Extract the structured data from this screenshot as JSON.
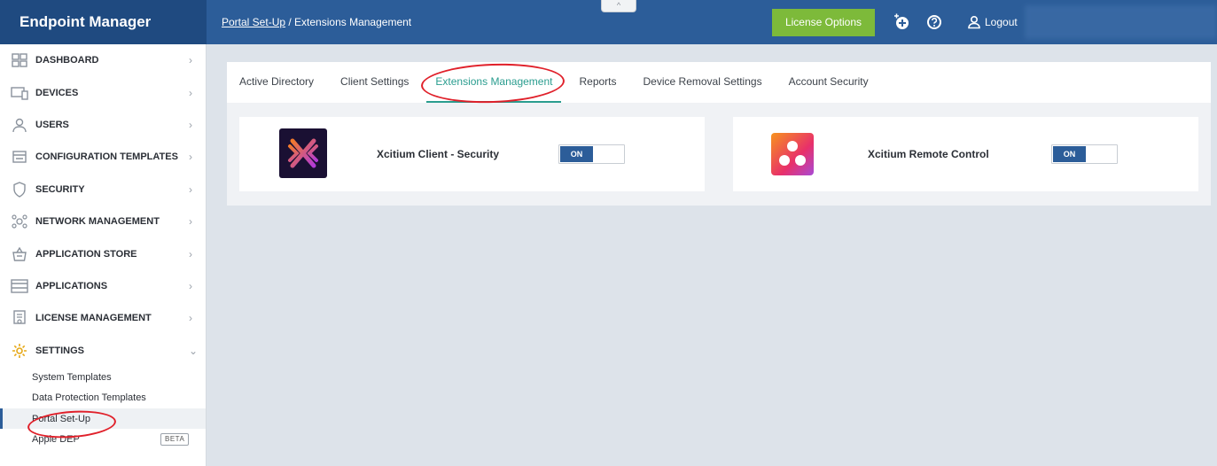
{
  "header": {
    "brand": "Endpoint Manager",
    "breadcrumb_link": "Portal Set-Up",
    "breadcrumb_sep": " / ",
    "breadcrumb_current": "Extensions Management",
    "collapse_glyph": "^",
    "license_options": "License Options",
    "logout": "Logout",
    "icons": [
      "add-circle-icon",
      "help-icon",
      "user-icon"
    ]
  },
  "sidebar": {
    "items": [
      {
        "label": "DASHBOARD",
        "icon": "dashboard-icon"
      },
      {
        "label": "DEVICES",
        "icon": "devices-icon"
      },
      {
        "label": "USERS",
        "icon": "users-icon"
      },
      {
        "label": "CONFIGURATION TEMPLATES",
        "icon": "templates-icon"
      },
      {
        "label": "SECURITY",
        "icon": "shield-icon"
      },
      {
        "label": "NETWORK MANAGEMENT",
        "icon": "network-icon"
      },
      {
        "label": "APPLICATION STORE",
        "icon": "store-icon"
      },
      {
        "label": "APPLICATIONS",
        "icon": "applications-icon"
      },
      {
        "label": "LICENSE MANAGEMENT",
        "icon": "license-icon"
      },
      {
        "label": "SETTINGS",
        "icon": "gear-icon"
      }
    ],
    "settings_sub": [
      {
        "label": "System Templates"
      },
      {
        "label": "Data Protection Templates"
      },
      {
        "label": "Portal Set-Up"
      },
      {
        "label": "Apple DEP",
        "badge": "BETA"
      }
    ]
  },
  "tabs": [
    {
      "label": "Active Directory"
    },
    {
      "label": "Client Settings"
    },
    {
      "label": "Extensions Management"
    },
    {
      "label": "Reports"
    },
    {
      "label": "Device Removal Settings"
    },
    {
      "label": "Account Security"
    }
  ],
  "extensions": [
    {
      "name": "Xcitium Client - Security",
      "toggle": "ON"
    },
    {
      "name": "Xcitium Remote Control",
      "toggle": "ON"
    }
  ],
  "colors": {
    "header_bg": "#2c5d99",
    "brand_bg": "#1f4a80",
    "license_button": "#7dba3a",
    "active_tab": "#2a9d8f",
    "annotation": "#e0202a"
  }
}
